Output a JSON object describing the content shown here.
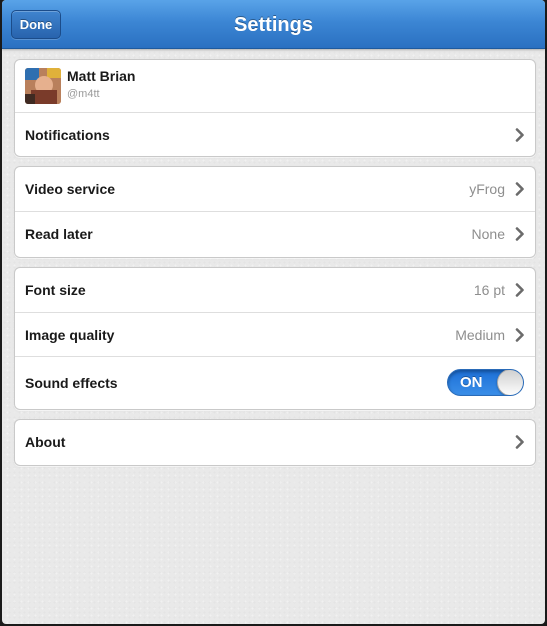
{
  "navbar": {
    "title": "Settings",
    "done_label": "Done"
  },
  "profile": {
    "name": "Matt Brian",
    "handle": "@m4tt"
  },
  "group1": {
    "notifications_label": "Notifications"
  },
  "group2": {
    "video_service_label": "Video service",
    "video_service_value": "yFrog",
    "read_later_label": "Read later",
    "read_later_value": "None"
  },
  "group3": {
    "font_size_label": "Font size",
    "font_size_value": "16 pt",
    "image_quality_label": "Image quality",
    "image_quality_value": "Medium",
    "sound_effects_label": "Sound effects",
    "sound_effects_state": "ON"
  },
  "group4": {
    "about_label": "About"
  },
  "icons": {
    "chevron": "chevron-right-icon"
  },
  "colors": {
    "navbar_blue": "#3c86d4",
    "toggle_on_blue": "#2a7fe0",
    "value_gray": "#8e8e8e"
  }
}
